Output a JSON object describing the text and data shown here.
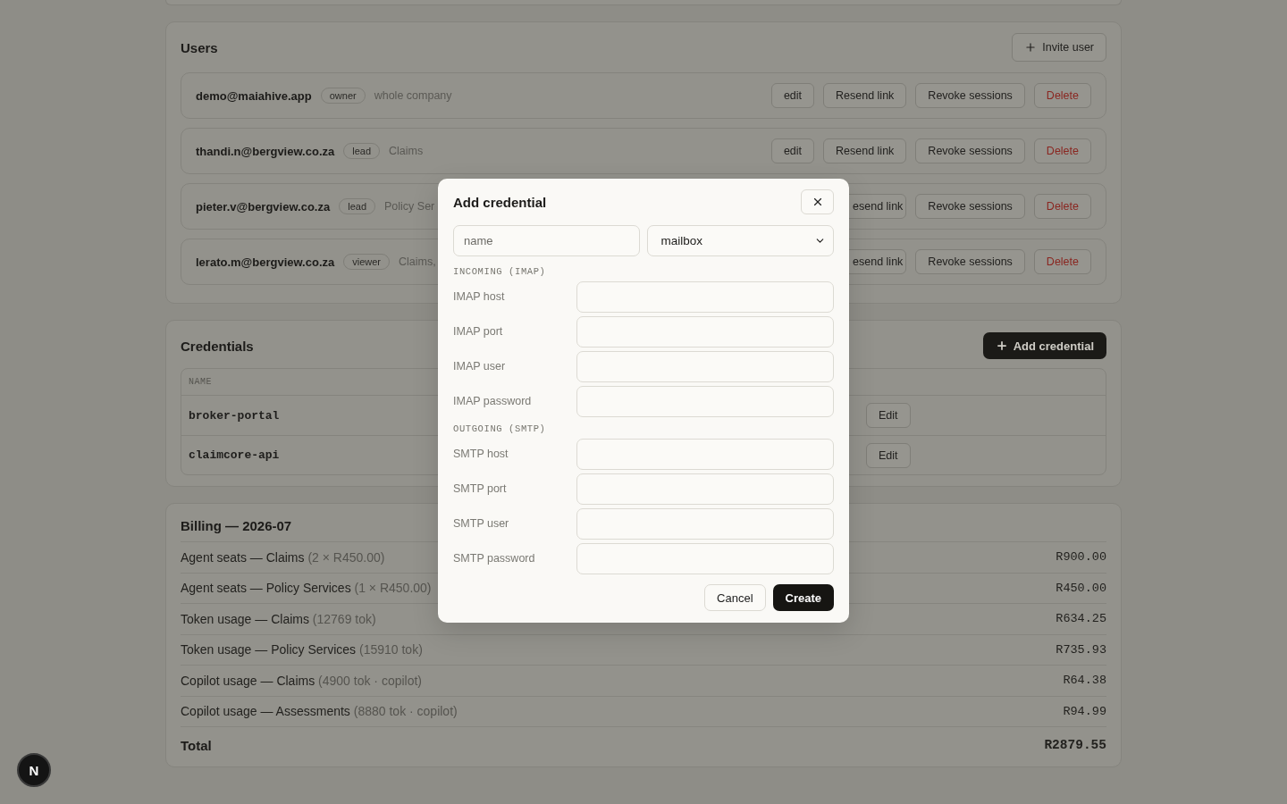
{
  "users": {
    "title": "Users",
    "invite_button": "Invite user",
    "rows": [
      {
        "email": "demo@maiahive.app",
        "role": "owner",
        "scope": "whole company",
        "actions": [
          {
            "label": "edit",
            "kind": "plain"
          },
          {
            "label": "Resend link",
            "kind": "plain"
          },
          {
            "label": "Revoke sessions",
            "kind": "plain"
          },
          {
            "label": "Delete",
            "kind": "danger"
          }
        ]
      },
      {
        "email": "thandi.n@bergview.co.za",
        "role": "lead",
        "scope": "Claims",
        "actions": [
          {
            "label": "edit",
            "kind": "plain"
          },
          {
            "label": "Resend link",
            "kind": "plain"
          },
          {
            "label": "Revoke sessions",
            "kind": "plain"
          },
          {
            "label": "Delete",
            "kind": "danger"
          }
        ]
      },
      {
        "email": "pieter.v@bergview.co.za",
        "role": "lead",
        "scope": "Policy Ser",
        "actions": [
          {
            "label": "esend link",
            "kind": "covered"
          },
          {
            "label": "Revoke sessions",
            "kind": "plain"
          },
          {
            "label": "Delete",
            "kind": "danger"
          }
        ]
      },
      {
        "email": "lerato.m@bergview.co.za",
        "role": "viewer",
        "scope": "Claims,",
        "actions": [
          {
            "label": "esend link",
            "kind": "covered"
          },
          {
            "label": "Revoke sessions",
            "kind": "plain"
          },
          {
            "label": "Delete",
            "kind": "danger"
          }
        ]
      }
    ]
  },
  "credentials": {
    "title": "Credentials",
    "add_button": "Add credential",
    "columns": [
      "NAME"
    ],
    "rows": [
      {
        "name": "broker-portal",
        "action": "Edit"
      },
      {
        "name": "claimcore-api",
        "action": "Edit"
      }
    ]
  },
  "billing": {
    "title": "Billing — 2026-07",
    "rows": [
      {
        "label": "Agent seats — Claims",
        "detail": "(2 × R450.00)",
        "amount": "R900.00"
      },
      {
        "label": "Agent seats — Policy Services",
        "detail": "(1 × R450.00)",
        "amount": "R450.00"
      },
      {
        "label": "Token usage — Claims",
        "detail": "(12769 tok)",
        "amount": "R634.25"
      },
      {
        "label": "Token usage — Policy Services",
        "detail": "(15910 tok)",
        "amount": "R735.93"
      },
      {
        "label": "Copilot usage — Claims",
        "detail": "(4900 tok · copilot)",
        "amount": "R64.38"
      },
      {
        "label": "Copilot usage — Assessments",
        "detail": "(8880 tok · copilot)",
        "amount": "R94.99"
      }
    ],
    "total_label": "Total",
    "total_amount": "R2879.55"
  },
  "dialog": {
    "title": "Add credential",
    "name_placeholder": "name",
    "type_value": "mailbox",
    "sections": [
      {
        "title": "INCOMING (IMAP)",
        "fields": [
          "IMAP host",
          "IMAP port",
          "IMAP user",
          "IMAP password"
        ]
      },
      {
        "title": "OUTGOING (SMTP)",
        "fields": [
          "SMTP host",
          "SMTP port",
          "SMTP user",
          "SMTP password"
        ]
      }
    ],
    "cancel_button": "Cancel",
    "create_button": "Create"
  },
  "dev_badge": "N"
}
